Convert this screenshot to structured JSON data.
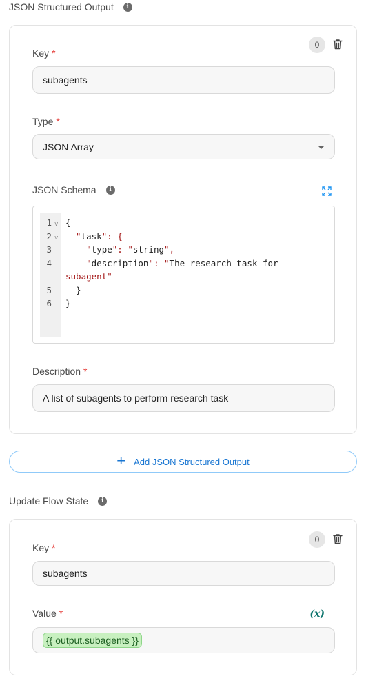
{
  "structured_output": {
    "title": "JSON Structured Output",
    "item": {
      "index_badge": "0",
      "key_label": "Key",
      "key_value": "subagents",
      "type_label": "Type",
      "type_value": "JSON Array",
      "schema_label": "JSON Schema",
      "schema_lines": [
        {
          "num": "1",
          "fold": "v",
          "text": "{"
        },
        {
          "num": "2",
          "fold": "v",
          "text": "  \"task\": {"
        },
        {
          "num": "3",
          "fold": "",
          "text": "    \"type\": \"string\","
        },
        {
          "num": "4",
          "fold": "",
          "text": "    \"description\": \"The research task for"
        },
        {
          "num": "",
          "fold": "",
          "text": "subagent\""
        },
        {
          "num": "5",
          "fold": "",
          "text": "  }"
        },
        {
          "num": "6",
          "fold": "",
          "text": "}"
        }
      ],
      "description_label": "Description",
      "description_value": "A list of subagents to perform research task"
    },
    "add_button_label": "Add JSON Structured Output"
  },
  "flow_state": {
    "title": "Update Flow State",
    "item": {
      "index_badge": "0",
      "key_label": "Key",
      "key_value": "subagents",
      "value_label": "Value",
      "value_icon": "(x)",
      "value_chip": "{{ output.subagents }}"
    }
  },
  "required_marker": "*",
  "colors": {
    "accent": "#1976d2",
    "required": "#e53935",
    "variable_chip_bg": "#c8f0c0",
    "variable_icon": "#0f766e",
    "string_token": "#a31515"
  }
}
